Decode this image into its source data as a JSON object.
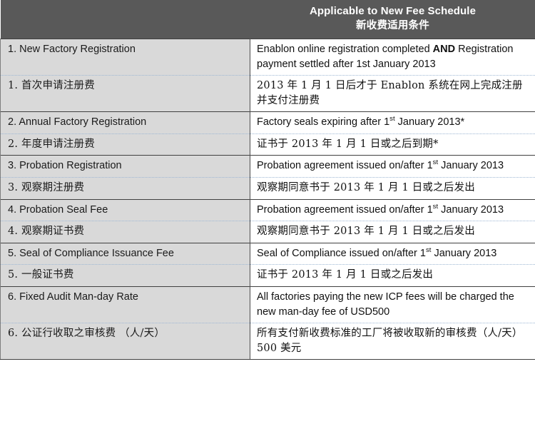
{
  "document": {
    "type": "table",
    "colors": {
      "header_bg": "#595959",
      "header_text": "#ffffff",
      "item_column_bg": "#D9D9D9",
      "condition_column_bg": "#ffffff",
      "group_separator": "#404040",
      "pair_separator": "#9db7d4"
    }
  },
  "table": {
    "header": {
      "item_column": "",
      "condition_column_en": "Applicable to New Fee Schedule",
      "condition_column_cn": "新收费适用条件"
    },
    "rows": [
      {
        "lang": "en",
        "separator": "solid",
        "item": "1. New Factory Registration",
        "condition_pre": "Enablon online registration completed ",
        "condition_bold": "AND",
        "condition_post": " Registration payment settled after 1st January 2013"
      },
      {
        "lang": "cn",
        "separator": "dotted",
        "item": "1. 首次申请注册费",
        "condition": "2013 年 1 月 1 日后才于 Enablon 系统在网上完成注册并支付注册费"
      },
      {
        "lang": "en",
        "separator": "solid",
        "item": "2. Annual Factory Registration",
        "condition_pre": "Factory seals expiring after 1",
        "condition_sup": "st",
        "condition_post": " January 2013*"
      },
      {
        "lang": "cn",
        "separator": "dotted",
        "item": "2. 年度申请注册费",
        "condition": "证书于 2013 年 1 月 1 日或之后到期*"
      },
      {
        "lang": "en",
        "separator": "solid",
        "item": "3. Probation Registration",
        "condition_pre": "Probation agreement issued on/after 1",
        "condition_sup": "st",
        "condition_post": " January 2013"
      },
      {
        "lang": "cn",
        "separator": "dotted",
        "item": "3. 观察期注册费",
        "condition": "观察期同意书于 2013 年 1 月 1 日或之后发出"
      },
      {
        "lang": "en",
        "separator": "solid",
        "item": "4. Probation Seal Fee",
        "condition_pre": "Probation agreement issued on/after 1",
        "condition_sup": "st",
        "condition_post": " January 2013"
      },
      {
        "lang": "cn",
        "separator": "dotted",
        "item": "4. 观察期证书费",
        "condition": "观察期同意书于 2013 年 1 月 1 日或之后发出"
      },
      {
        "lang": "en",
        "separator": "solid",
        "item": "5. Seal of Compliance Issuance Fee",
        "condition_pre": "Seal of Compliance issued on/after 1",
        "condition_sup": "st",
        "condition_post": " January 2013"
      },
      {
        "lang": "cn",
        "separator": "dotted",
        "item": "5. 一般证书费",
        "condition": "证书于 2013 年 1 月 1 日或之后发出"
      },
      {
        "lang": "en",
        "separator": "solid",
        "item": "6. Fixed Audit Man-day Rate",
        "condition_pre": "All factories paying the new ICP fees will be charged the new man-day fee of USD500",
        "condition_sup": "",
        "condition_post": ""
      },
      {
        "lang": "cn",
        "separator": "dotted",
        "item": "6. 公证行收取之审核费 （人/天）",
        "condition": "所有支付新收费标准的工厂将被收取新的审核费（人/天）500 美元"
      }
    ]
  }
}
